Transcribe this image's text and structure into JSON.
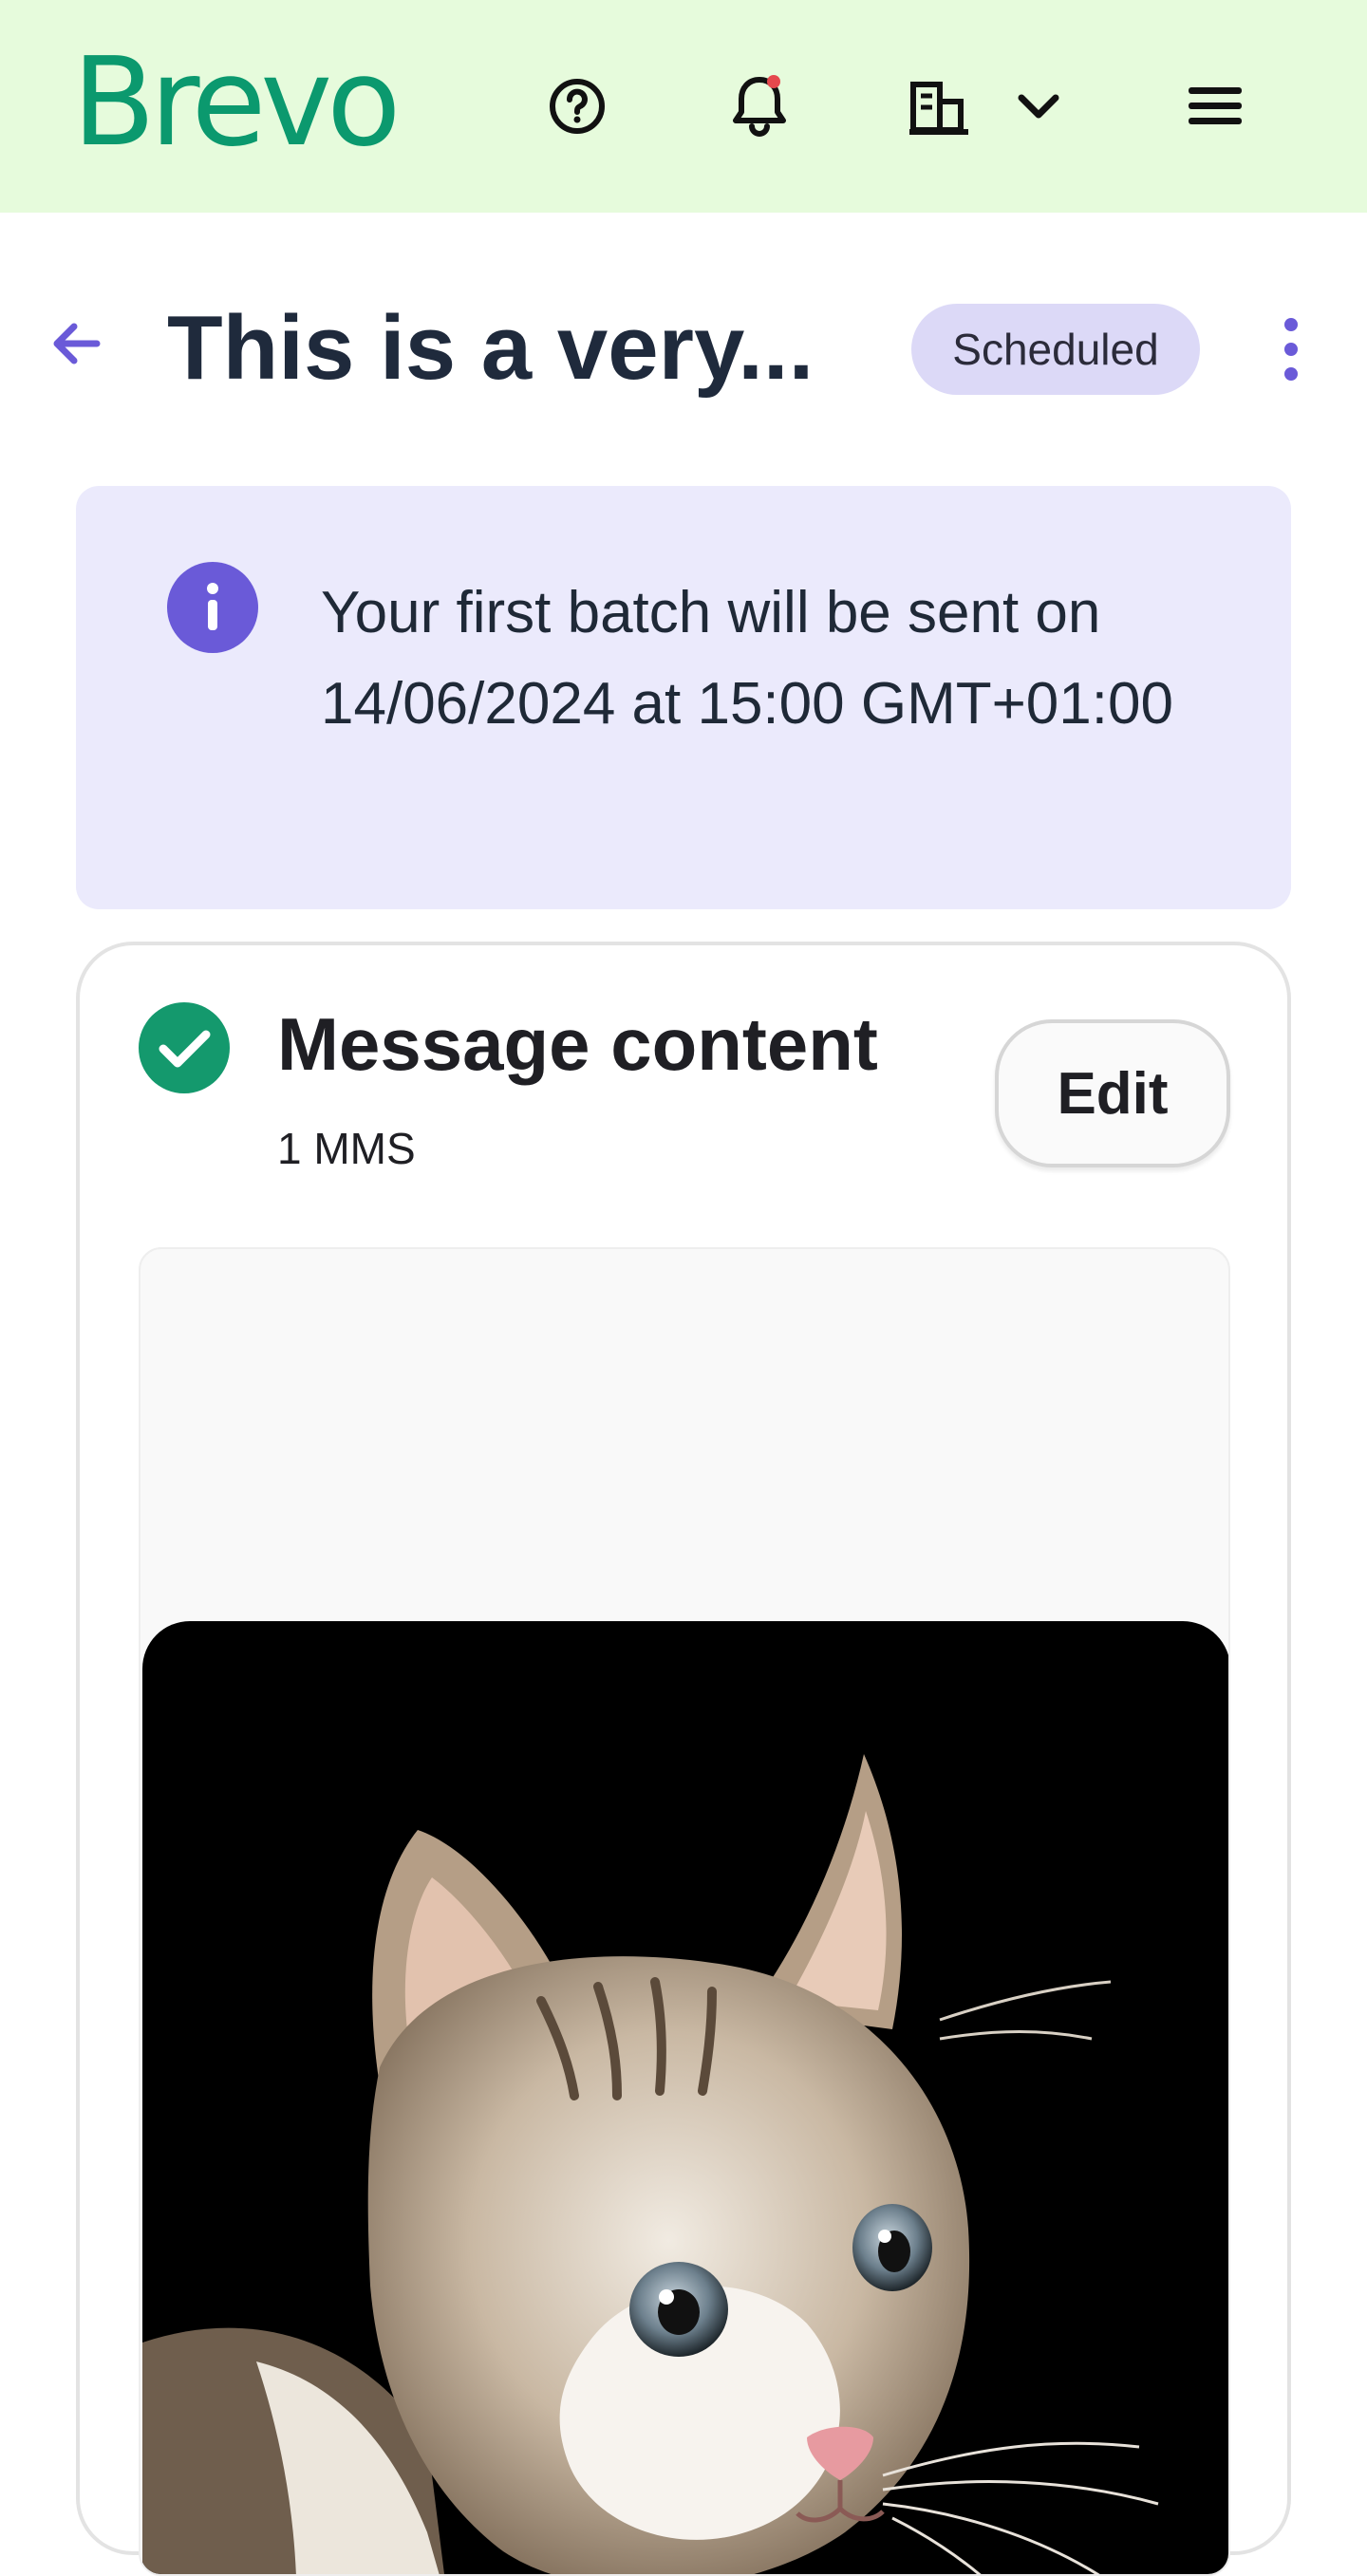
{
  "header": {
    "logo_text": "Brevo",
    "brand_color": "#0b996e",
    "background": "#e6fbdc",
    "icons": [
      "help-icon",
      "bell-icon",
      "building-icon",
      "chevron-down-icon",
      "hamburger-menu-icon"
    ],
    "notification_dot_color": "#e5484d"
  },
  "page": {
    "title": "This is a very...",
    "status_badge": "Scheduled"
  },
  "info_banner": {
    "text": "Your first batch will be sent on 14/06/2024 at 15:00 GMT+01:00",
    "accent": "#6a5ad8"
  },
  "message_card": {
    "title": "Message content",
    "subtitle": "1 MMS",
    "edit_label": "Edit",
    "status_color": "#14996d",
    "image": "cat-photo"
  }
}
